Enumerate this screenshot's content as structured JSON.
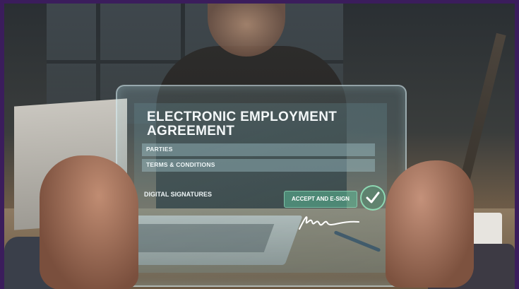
{
  "document": {
    "title_line1": "ELECTRONIC EMPLOYMENT",
    "title_line2": "AGREEMENT",
    "sections": [
      "PARTIES",
      "TERMS & CONDITIONS"
    ],
    "signatures_label": "DIGITAL SIGNATURES",
    "accept_button": "ACCEPT AND E-SIGN"
  },
  "icons": {
    "check": "checkmark-icon",
    "signature": "handwritten-signature"
  },
  "colors": {
    "frame": "#3b1d5c",
    "accept": "#5ab996",
    "glass_text": "#f3f7f8"
  }
}
